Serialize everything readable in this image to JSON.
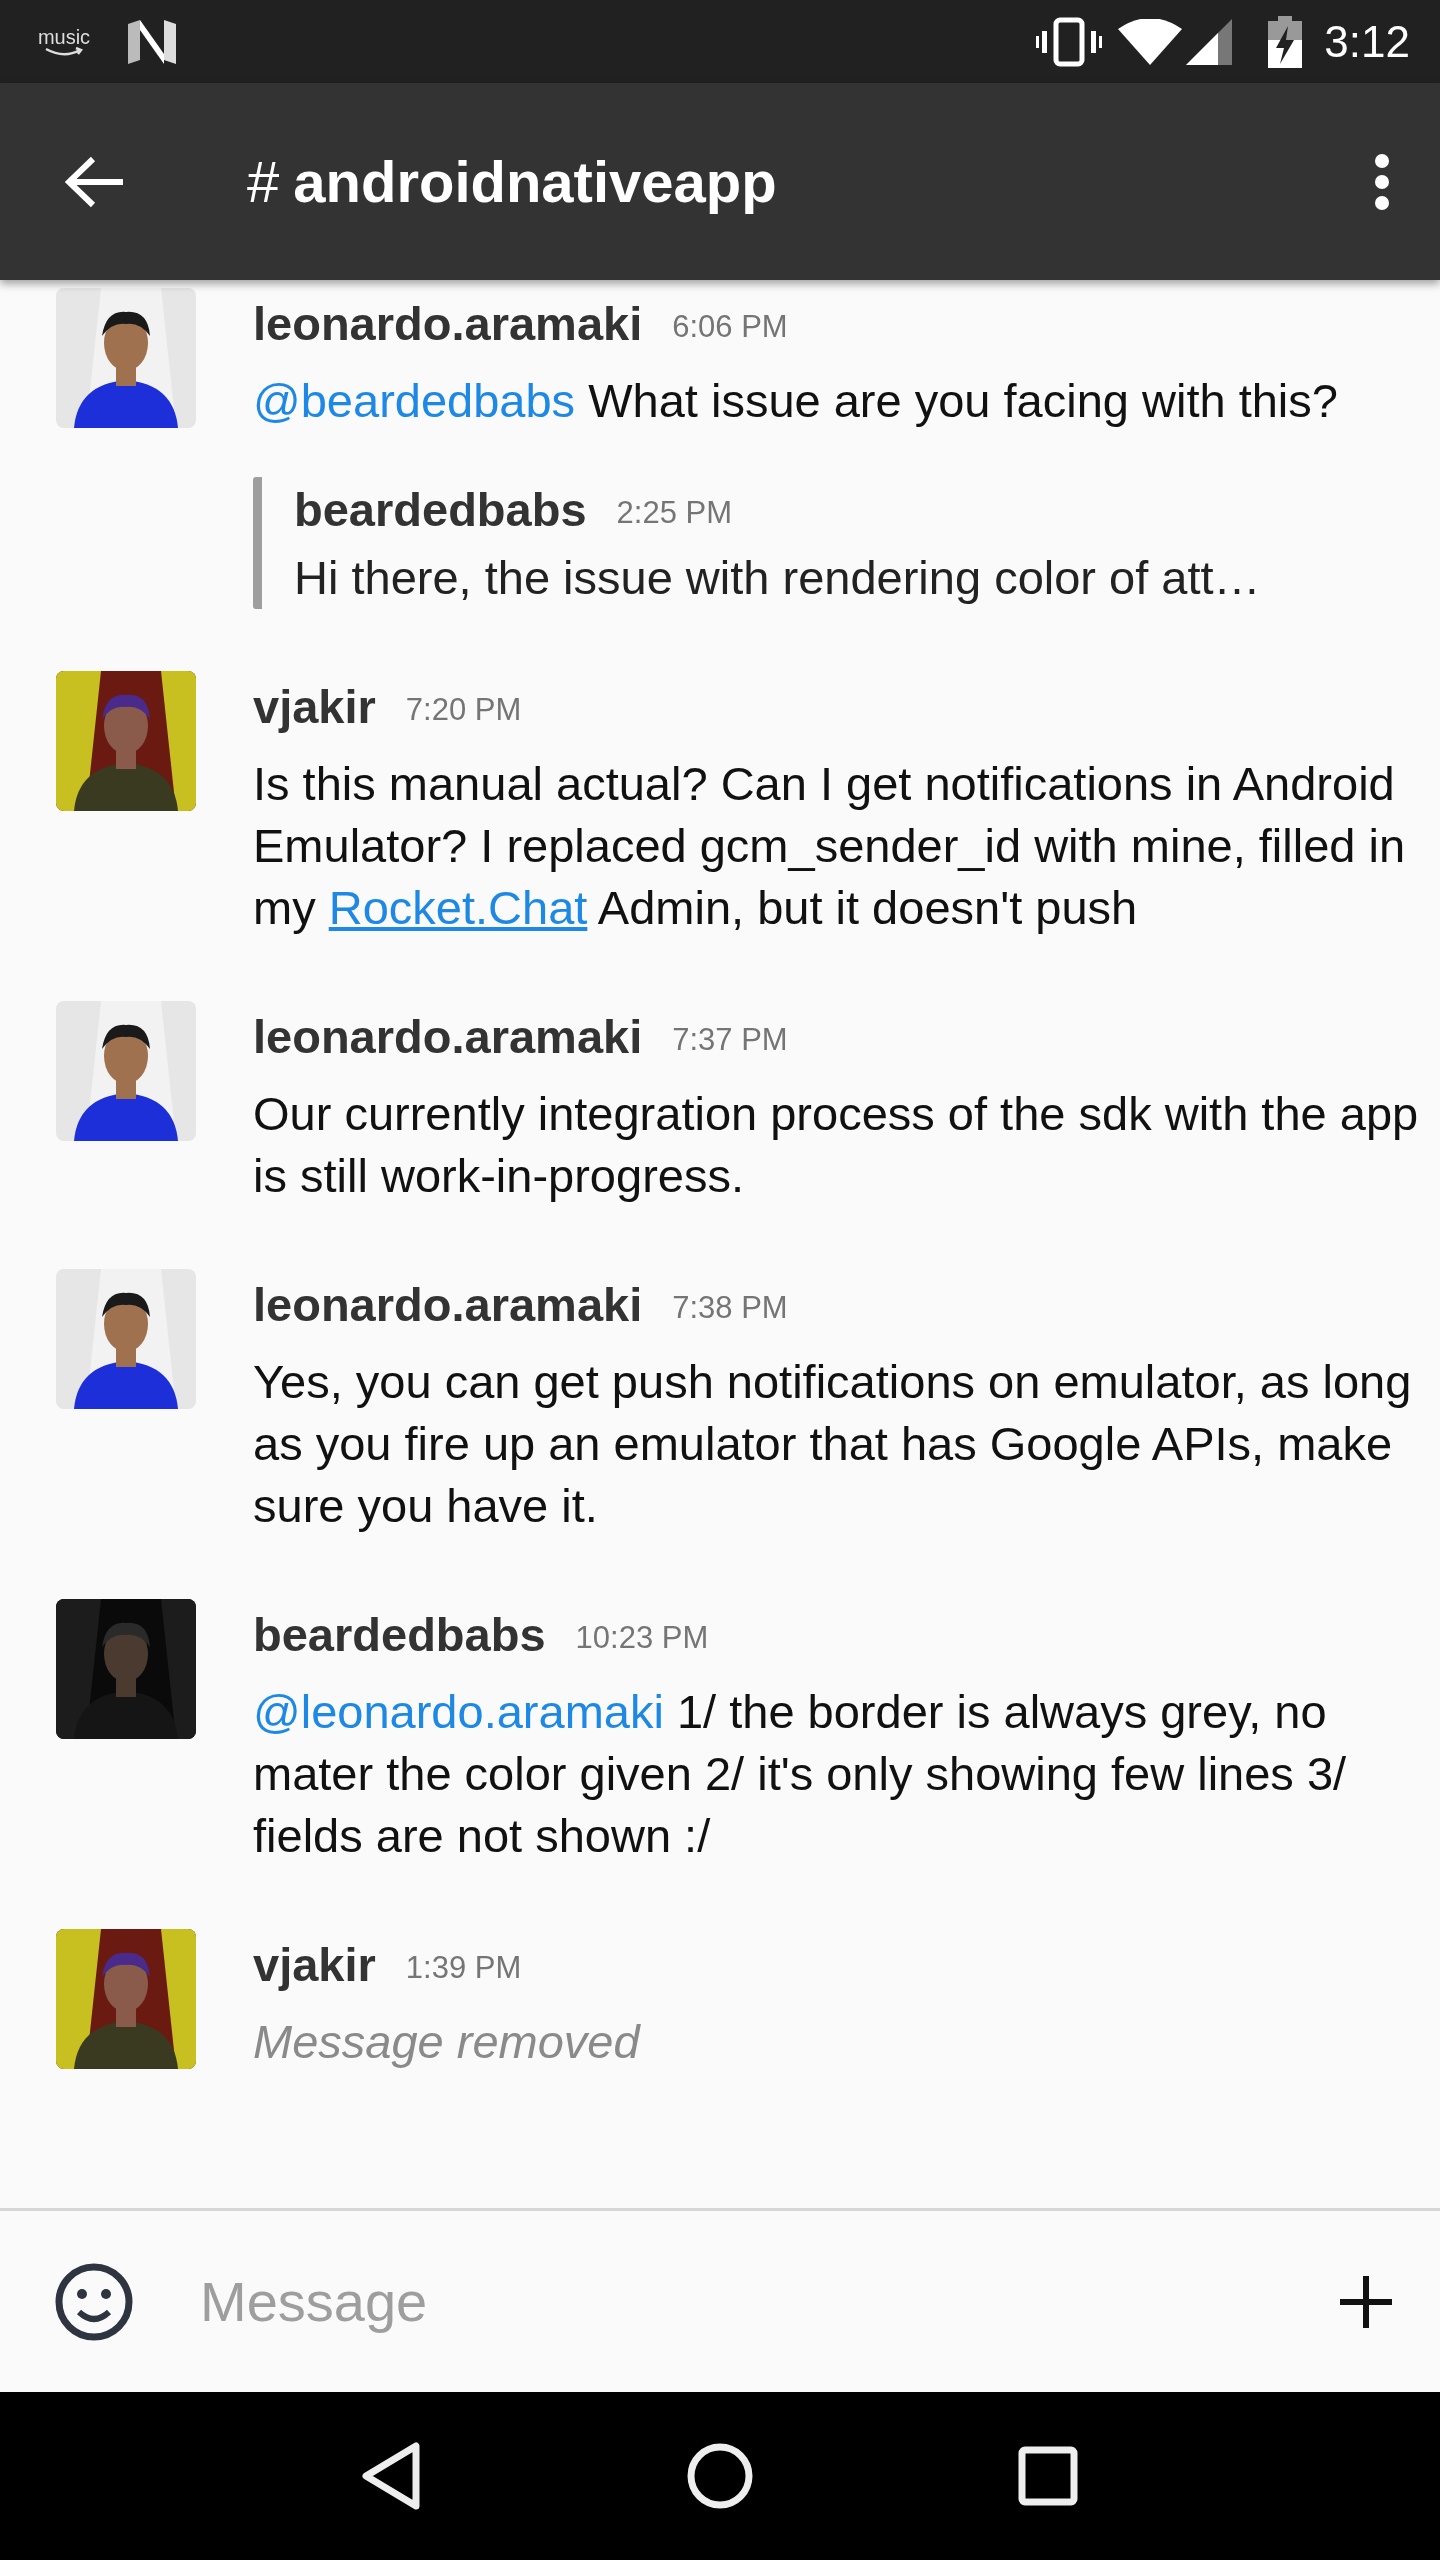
{
  "status_bar": {
    "logo_text": "music",
    "time": "3:12"
  },
  "app_bar": {
    "prefix": "#",
    "title": "androidnativeapp"
  },
  "messages": [
    {
      "user": "leonardo.aramaki",
      "time": "6:06 PM",
      "avatar": {
        "kind": "picture"
      },
      "body": [
        {
          "kind": "mention",
          "text": "@beardedbabs"
        },
        {
          "kind": "text",
          "text": " What issue are you facing with this?"
        }
      ],
      "quote": {
        "user": "beardedbabs",
        "time": "2:25 PM",
        "text": "Hi there, the issue with rendering color of att…"
      }
    },
    {
      "user": "vjakir",
      "time": "7:20 PM",
      "avatar": {
        "kind": "picture"
      },
      "body": [
        {
          "kind": "text",
          "text": "Is this manual actual? Can I get notifications in Android Emulator? I replaced gcm_sender_id with mine, filled in my "
        },
        {
          "kind": "link",
          "text": "Rocket.Chat"
        },
        {
          "kind": "text",
          "text": " Admin, but it doesn't push"
        }
      ]
    },
    {
      "user": "leonardo.aramaki",
      "time": "7:37 PM",
      "avatar": {
        "kind": "picture"
      },
      "body": [
        {
          "kind": "text",
          "text": "Our currently integration process of the sdk with the app is still work-in-progress."
        }
      ]
    },
    {
      "user": "leonardo.aramaki",
      "time": "7:38 PM",
      "avatar": {
        "kind": "picture"
      },
      "body": [
        {
          "kind": "text",
          "text": "Yes, you can get push notifications on emulator, as long as you fire up an emulator that has Google APIs, make sure you have it."
        }
      ]
    },
    {
      "user": "beardedbabs",
      "time": "10:23 PM",
      "avatar": {
        "kind": "picture"
      },
      "body": [
        {
          "kind": "mention",
          "text": "@leonardo.aramaki"
        },
        {
          "kind": "text",
          "text": " 1/ the border is always grey, no mater the color given 2/ it's only showing few lines 3/ fields are not shown :/"
        }
      ]
    },
    {
      "user": "vjakir",
      "time": "1:39 PM",
      "avatar": {
        "kind": "picture"
      },
      "body": [
        {
          "kind": "removed",
          "text": "Message removed"
        }
      ]
    }
  ],
  "composer": {
    "placeholder": "Message"
  }
}
